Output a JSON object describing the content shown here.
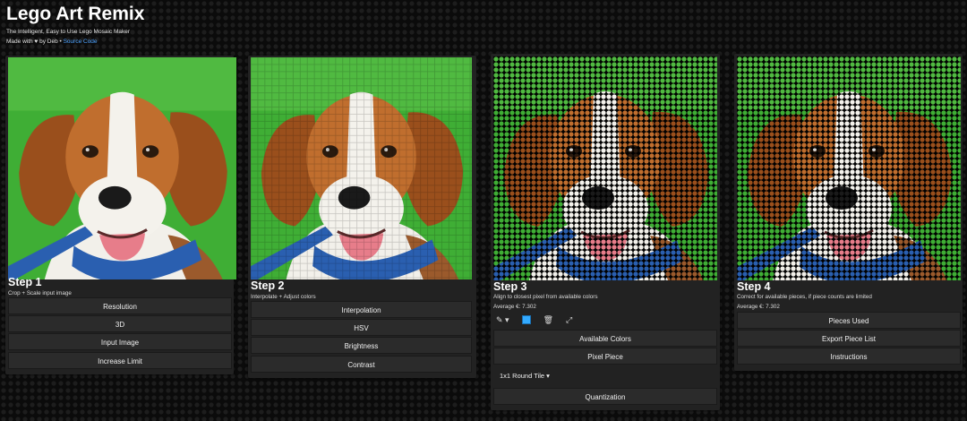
{
  "app": {
    "title": "Lego Art Remix",
    "subtitle": "The Intelligent, Easy to Use Lego Mosaic Maker",
    "made_with": "Made with ♥ by Deb •",
    "source_link": "Source Code"
  },
  "step1": {
    "title": "Step 1",
    "desc": "Crop + Scale input image",
    "buttons": [
      "Resolution",
      "3D",
      "Input Image",
      "Increase Limit"
    ]
  },
  "step2": {
    "title": "Step 2",
    "desc": "Interpolate + Adjust colors",
    "buttons": [
      "Interpolation",
      "HSV",
      "Brightness",
      "Contrast"
    ]
  },
  "step3": {
    "title": "Step 3",
    "desc": "Align to closest pixel from available colors",
    "average": "Average €: 7.302",
    "tools": [
      "pencil-icon",
      "color-swatch-icon",
      "trash-icon",
      "expand-icon"
    ],
    "buttons": [
      "Available Colors",
      "Pixel Piece"
    ],
    "piece_select": "1x1 Round Tile ▾",
    "last_button": "Quantization"
  },
  "step4": {
    "title": "Step 4",
    "desc": "Correct for available pieces, if piece counts are limited",
    "average": "Average €: 7.302",
    "buttons": [
      "Pieces Used",
      "Export Piece List",
      "Instructions"
    ]
  },
  "colors": {
    "background": "#0b0b0b",
    "card": "#222222",
    "button": "#2b2b2b",
    "link": "#4ea3ff",
    "swatch": "#33aaff",
    "grass": "#3fb83a",
    "fur_brown": "#b25f2a",
    "fur_white": "#f2f0ea",
    "collar": "#2a5fb0",
    "tongue": "#e77d8a",
    "nose": "#1a1a1a"
  }
}
